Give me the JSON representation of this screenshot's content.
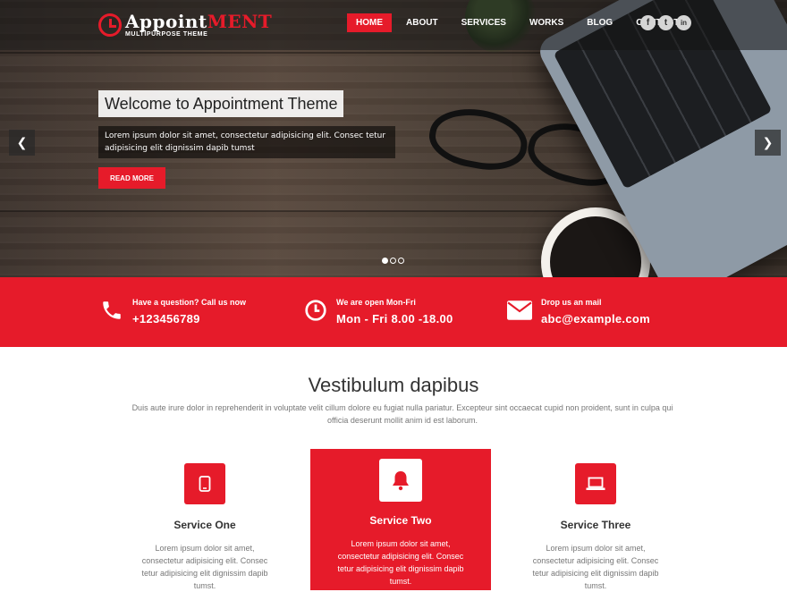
{
  "brand": {
    "title_main": "Appoint",
    "title_accent": "ment",
    "subtitle": "MULTIPURPOSE THEME"
  },
  "nav": {
    "items": [
      {
        "label": "HOME",
        "active": true
      },
      {
        "label": "ABOUT"
      },
      {
        "label": "SERVICES"
      },
      {
        "label": "WORKS"
      },
      {
        "label": "BLOG"
      },
      {
        "label": "CONTACT"
      }
    ]
  },
  "social": [
    {
      "icon": "facebook-icon",
      "glyph": "f"
    },
    {
      "icon": "twitter-icon",
      "glyph": "t"
    },
    {
      "icon": "linkedin-icon",
      "glyph": "in"
    }
  ],
  "slider": {
    "title": "Welcome to Appointment Theme",
    "text": "Lorem ipsum dolor sit amet, consectetur adipisicing elit. Consec tetur adipisicing elit dignissim dapib tumst",
    "button": "READ MORE",
    "prev_glyph": "❮",
    "next_glyph": "❯",
    "current_slide": 1,
    "slide_count": 3
  },
  "info": [
    {
      "icon": "phone-icon",
      "label": "Have a question? Call us now",
      "value": "+123456789"
    },
    {
      "icon": "clock-icon",
      "label": "We are open Mon-Fri",
      "value": "Mon - Fri 8.00 -18.00"
    },
    {
      "icon": "mail-icon",
      "label": "Drop us an mail",
      "value": "abc@example.com"
    }
  ],
  "services": {
    "title": "Vestibulum dapibus",
    "description": "Duis aute irure dolor in reprehenderit in voluptate velit cillum dolore eu fugiat nulla pariatur. Excepteur sint occaecat cupid non proident, sunt in culpa qui officia deserunt mollit anim id est laborum.",
    "items": [
      {
        "icon": "mobile-icon",
        "name": "Service One",
        "text": "Lorem ipsum dolor sit amet, consectetur adipisicing elit. Consec tetur adipisicing elit dignissim dapib tumst."
      },
      {
        "icon": "bell-icon",
        "name": "Service Two",
        "text": "Lorem ipsum dolor sit amet, consectetur adipisicing elit. Consec tetur adipisicing elit dignissim dapib tumst.",
        "featured": true
      },
      {
        "icon": "laptop-icon",
        "name": "Service Three",
        "text": "Lorem ipsum dolor sit amet, consectetur adipisicing elit. Consec tetur adipisicing elit dignissim dapib tumst."
      }
    ]
  },
  "colors": {
    "accent": "#e61b2a"
  }
}
